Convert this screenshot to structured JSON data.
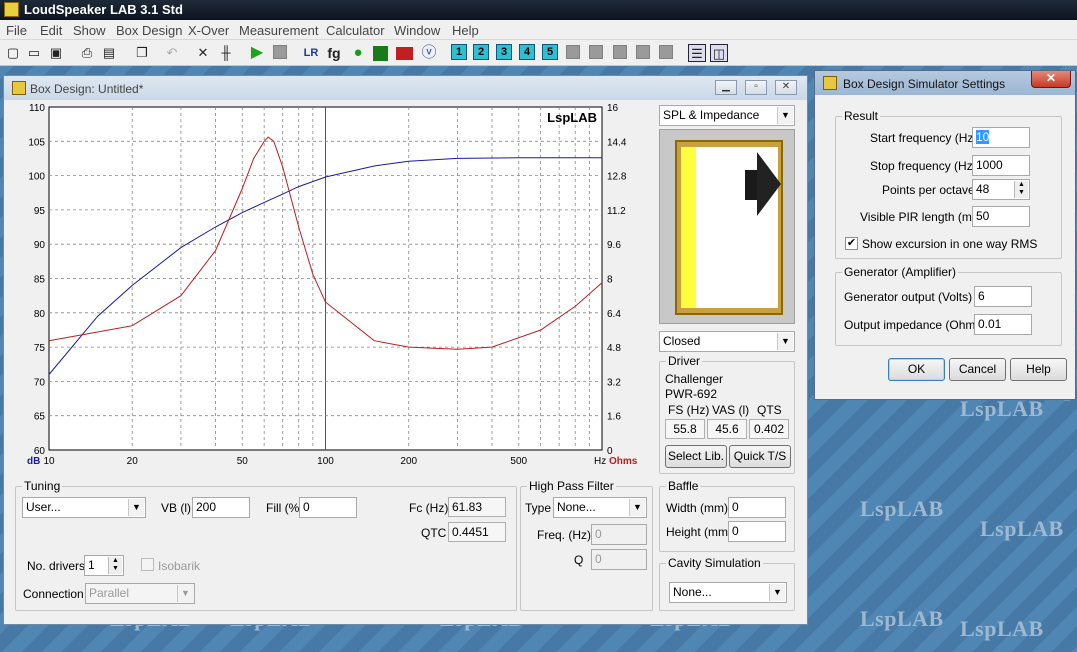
{
  "app": {
    "title": "LoudSpeaker LAB 3.1 Std"
  },
  "watermark": "LspLAB",
  "menu": [
    "File",
    "Edit",
    "Show",
    "Box Design",
    "X-Over",
    "Measurement",
    "Calculator",
    "Window",
    "Help"
  ],
  "toolbar": {
    "num_buttons": [
      "1",
      "2",
      "3",
      "4",
      "5"
    ],
    "lr_label": "LR",
    "fg_label": "fg"
  },
  "box_window": {
    "title": "Box Design: Untitled*",
    "graph": {
      "logo": "LspLAB",
      "left_unit": "dB",
      "right_unit": "Ohms",
      "x_unit": "Hz",
      "y_ticks": [
        "110",
        "105",
        "100",
        "95",
        "90",
        "85",
        "80",
        "75",
        "70",
        "65",
        "60"
      ],
      "y2_ticks": [
        "16",
        "14.4",
        "12.8",
        "11.2",
        "9.6",
        "8",
        "6.4",
        "4.8",
        "3.2",
        "1.6",
        "0"
      ],
      "x_ticks": [
        "10",
        "20",
        "50",
        "100",
        "200",
        "500"
      ]
    },
    "chart_data": {
      "type": "line",
      "xlim": [
        10,
        1000
      ],
      "ylim": [
        60,
        110
      ],
      "y2lim": [
        0,
        16
      ],
      "xscale": "log",
      "grid": true,
      "series": [
        {
          "axis": "left",
          "color": "#1a1a9c",
          "x": [
            10,
            15,
            20,
            30,
            40,
            50,
            60,
            70,
            80,
            100,
            150,
            200,
            300,
            500,
            1000
          ],
          "values": [
            71,
            79.5,
            84,
            89.5,
            92.5,
            94.6,
            96.1,
            97.3,
            98.4,
            99.8,
            101.4,
            102.1,
            102.5,
            102.6,
            102.6
          ]
        },
        {
          "axis": "right",
          "color": "#b82020",
          "x": [
            10,
            20,
            30,
            40,
            50,
            55,
            60,
            62,
            65,
            70,
            80,
            90,
            100,
            150,
            200,
            300,
            400,
            600,
            800,
            1000
          ],
          "values": [
            5.1,
            5.8,
            7.2,
            9.3,
            12.2,
            13.6,
            14.4,
            14.6,
            14.4,
            13.2,
            10.4,
            8.2,
            6.9,
            5.1,
            4.8,
            4.7,
            4.8,
            5.6,
            6.7,
            7.8
          ]
        }
      ]
    },
    "right_panel": {
      "view_select": "SPL & Impedance",
      "box_type": "Closed",
      "driver": {
        "label": "Driver",
        "brand": "Challenger",
        "model": "PWR-692",
        "fs_label": "FS (Hz)",
        "vas_label": "VAS (l)",
        "qts_label": "QTS",
        "fs": "55.8",
        "vas": "45.6",
        "qts": "0.402",
        "select_lib": "Select Lib.",
        "quick_ts": "Quick T/S"
      }
    },
    "tuning": {
      "label": "Tuning",
      "preset": "User...",
      "vb_label": "VB (l)",
      "vb": "200",
      "fill_label": "Fill (%)",
      "fill": "0",
      "fc_label": "Fc (Hz)",
      "fc": "61.83",
      "qtc_label": "QTC",
      "qtc": "0.4451",
      "drivers_label": "No. drivers",
      "drivers": "1",
      "isobarik_label": "Isobarik",
      "connection_label": "Connection",
      "connection": "Parallel"
    },
    "hpf": {
      "label": "High Pass Filter",
      "type_label": "Type",
      "type": "None...",
      "freq_label": "Freq. (Hz)",
      "freq": "0",
      "q_label": "Q",
      "q": "0"
    },
    "baffle": {
      "label": "Baffle",
      "width_label": "Width (mm)",
      "width": "0",
      "height_label": "Height (mm)",
      "height": "0"
    },
    "cavity": {
      "label": "Cavity Simulation",
      "value": "None..."
    }
  },
  "settings": {
    "title": "Box Design Simulator Settings",
    "result_label": "Result",
    "start_label": "Start frequency (Hz)",
    "start": "10",
    "stop_label": "Stop frequency (Hz)",
    "stop": "1000",
    "ppo_label": "Points per octave",
    "ppo": "48",
    "pir_label": "Visible PIR length (ms)",
    "pir": "50",
    "excursion_label": "Show excursion in one way RMS",
    "excursion_checked": true,
    "gen_label": "Generator (Amplifier)",
    "out_label": "Generator output (Volts)",
    "out": "6",
    "imp_label": "Output impedance (Ohms)",
    "imp": "0.01",
    "ok": "OK",
    "cancel": "Cancel",
    "help": "Help"
  }
}
